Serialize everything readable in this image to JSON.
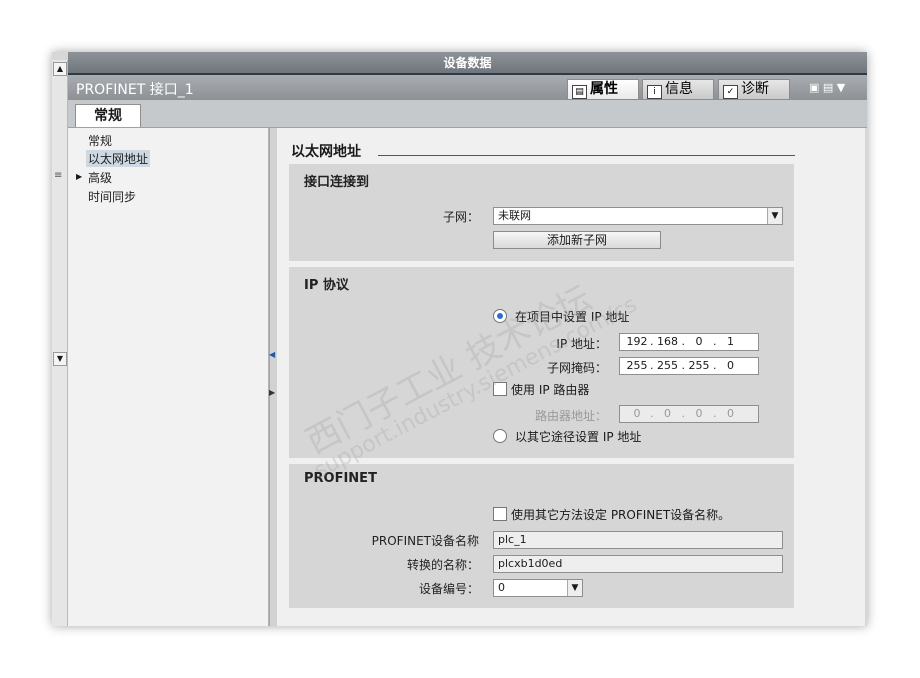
{
  "window": {
    "title": "设备数据"
  },
  "header": {
    "title": "PROFINET 接口_1",
    "tabs": [
      {
        "label": "属性",
        "icon": "properties-icon",
        "active": true
      },
      {
        "label": "信息",
        "icon": "info-icon",
        "active": false
      },
      {
        "label": "诊断",
        "icon": "diagnostics-icon",
        "active": false
      }
    ],
    "controls": "▣ ▤ ▼"
  },
  "main_tab": "常规",
  "nav": {
    "items": [
      {
        "label": "常规",
        "selected": false,
        "expandable": false
      },
      {
        "label": "以太网地址",
        "selected": true,
        "expandable": false
      },
      {
        "label": "高级",
        "selected": false,
        "expandable": true
      },
      {
        "label": "时间同步",
        "selected": false,
        "expandable": false
      }
    ]
  },
  "page_title": "以太网地址",
  "interface": {
    "title": "接口连接到",
    "subnet_label": "子网：",
    "subnet_value": "未联网",
    "add_subnet_button": "添加新子网"
  },
  "ip": {
    "title": "IP 协议",
    "option_project": "在项目中设置 IP 地址",
    "ip_label": "IP 地址：",
    "ip_octets": [
      "192",
      "168",
      "0",
      "1"
    ],
    "mask_label": "子网掩码：",
    "mask_octets": [
      "255",
      "255",
      "255",
      "0"
    ],
    "use_router": "使用 IP 路由器",
    "router_label": "路由器地址：",
    "router_octets": [
      "0",
      "0",
      "0",
      "0"
    ],
    "option_other": "以其它途径设置 IP 地址"
  },
  "profinet": {
    "title": "PROFINET",
    "other_method": "使用其它方法设定 PROFINET设备名称。",
    "name_label": "PROFINET设备名称",
    "name_value": "plc_1",
    "converted_label": "转换的名称：",
    "converted_value": "plcxb1d0ed",
    "number_label": "设备编号：",
    "number_value": "0"
  },
  "watermark": {
    "line1": "西门子工业   技术论坛",
    "line2": "support.industry.siemens.com/cs"
  },
  "colors": {
    "title_bar": "#7a8086",
    "header_bar": "#9a9ea3",
    "section_bg": "#d6d6d6",
    "radio_on": "#2a6fd6"
  }
}
